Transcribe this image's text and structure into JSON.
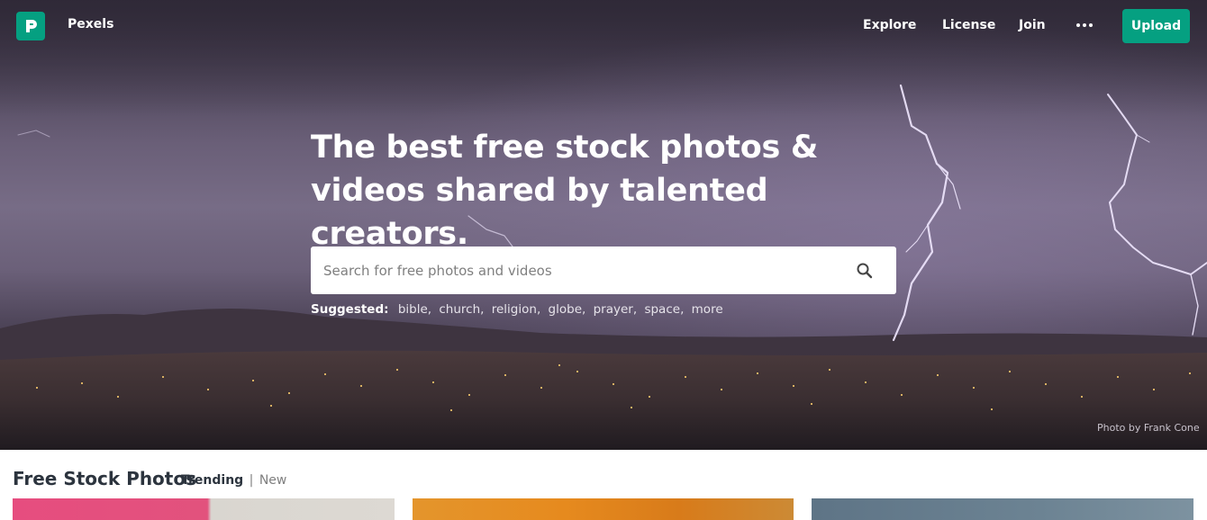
{
  "nav": {
    "brand": "Pexels",
    "links": [
      "Explore",
      "License",
      "Join"
    ],
    "upload_label": "Upload"
  },
  "hero": {
    "headline": "The best free stock photos & videos shared by talented creators.",
    "search": {
      "placeholder": "Search for free photos and videos"
    },
    "suggested_label": "Suggested:",
    "suggested": [
      "bible",
      "church",
      "religion",
      "globe",
      "prayer",
      "space",
      "more"
    ],
    "credit": "Photo by Frank Cone"
  },
  "section": {
    "title": "Free Stock Photos",
    "filters": {
      "active": "Trending",
      "separator": "|",
      "other": "New"
    }
  },
  "colors": {
    "brand": "#05a081",
    "text": "#2c343e",
    "muted": "#7f7f7f"
  },
  "icons": {
    "logo": "pexels-logo-icon",
    "more": "more-dots-icon",
    "search": "search-icon"
  }
}
